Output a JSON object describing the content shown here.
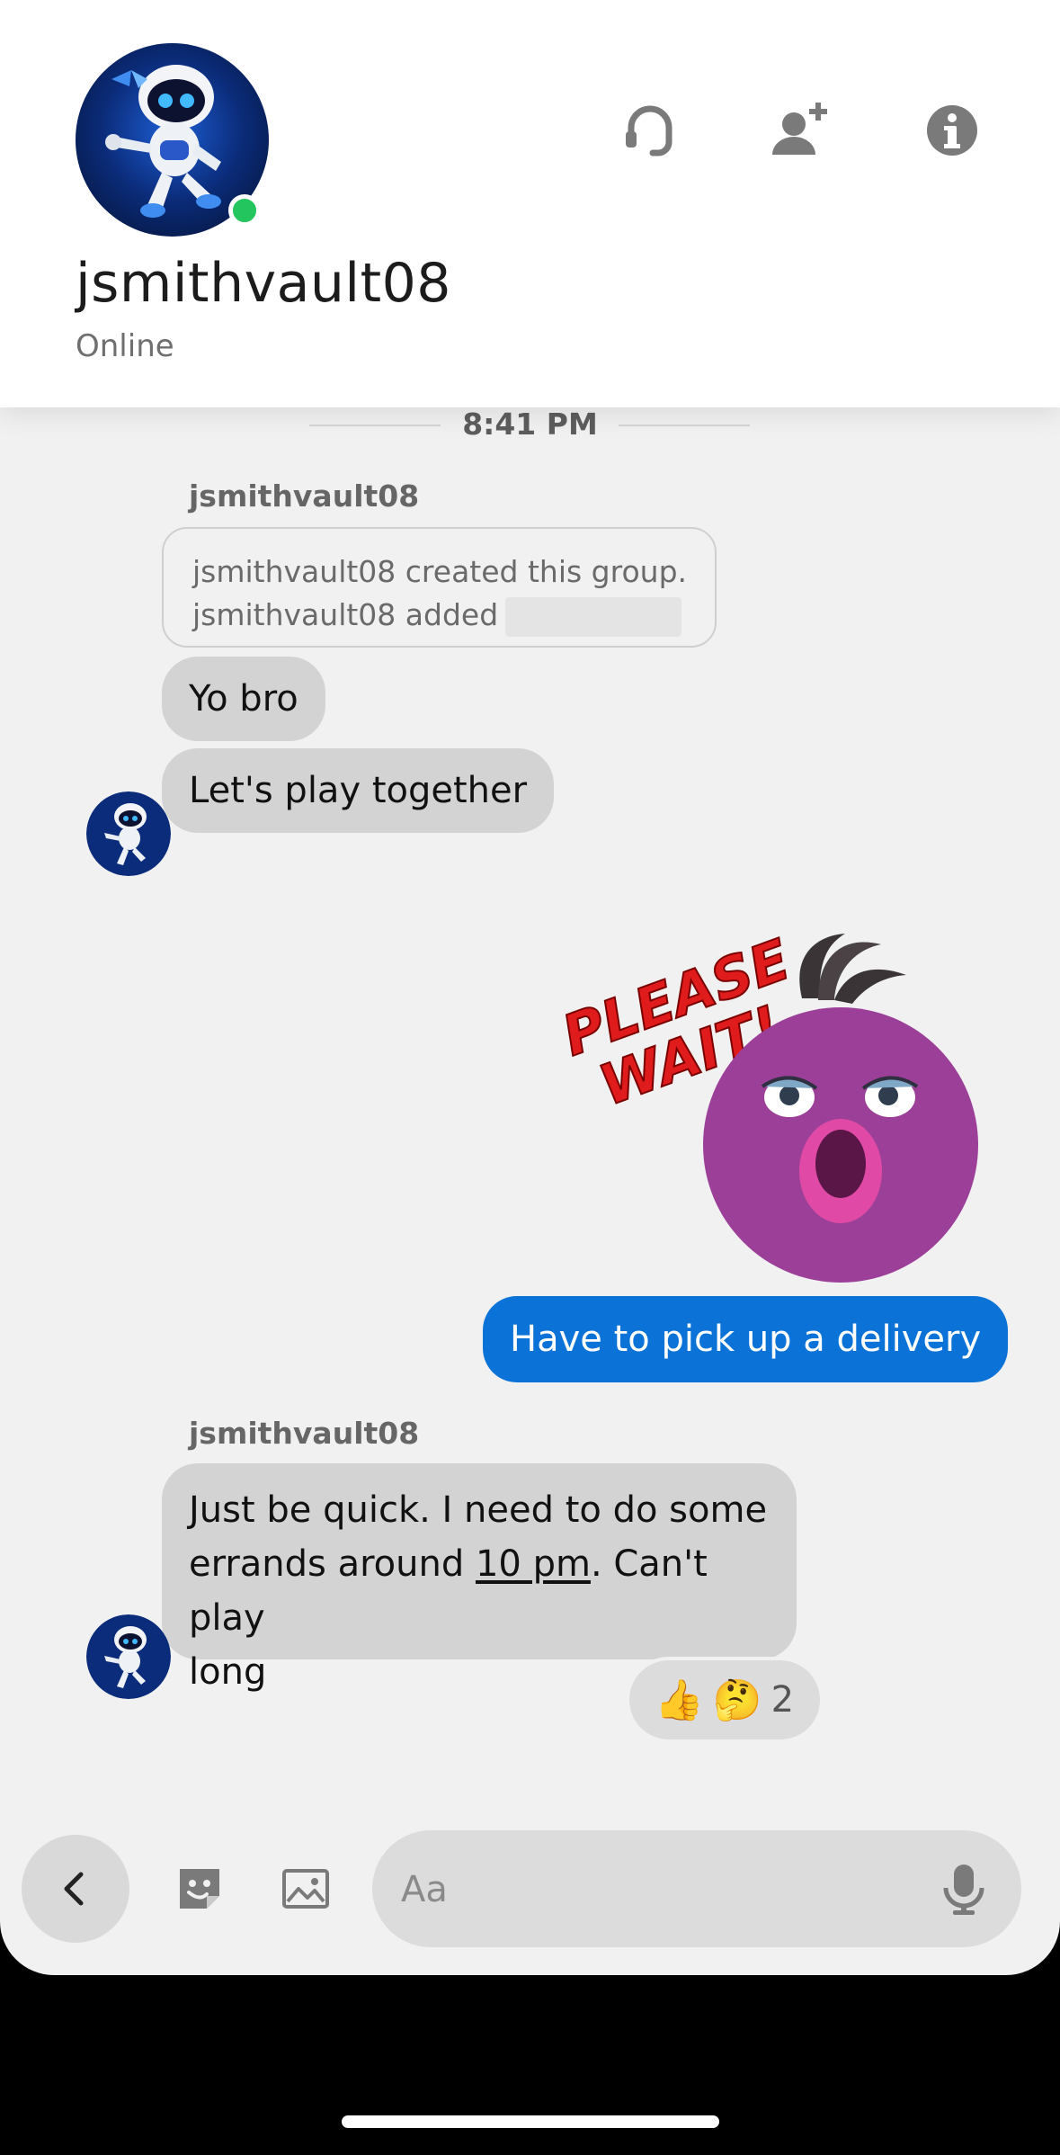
{
  "header": {
    "username": "jsmithvault08",
    "status": "Online",
    "icons": [
      "headset-icon",
      "add-friend-icon",
      "info-icon"
    ]
  },
  "timestamp": "8:41 PM",
  "messages": {
    "sender_1": "jsmithvault08",
    "system_line_1": "jsmithvault08 created this group.",
    "system_line_2_prefix": "jsmithvault08 added",
    "system_line_2_suffix": ".",
    "bubble_1": "Yo bro",
    "bubble_2": "Let's play together",
    "sticker_text_1": "PLEASE",
    "sticker_text_2": "WAIT!",
    "outgoing_1": "Have to pick up a delivery",
    "sender_2": "jsmithvault08",
    "long_line_1": "Just be quick. I need to do some",
    "long_line_2_prefix": "errands around ",
    "long_line_2_link": "10 pm",
    "long_line_2_suffix": ". Can't play",
    "long_line_3": "long",
    "reaction_emoji_1": "👍",
    "reaction_emoji_2": "🤔",
    "reaction_count": "2"
  },
  "composer": {
    "placeholder": "Aa"
  },
  "colors": {
    "outgoing_bubble": "#0b73d8",
    "incoming_bubble": "#d3d3d3",
    "online": "#22c55e",
    "sticker_purple": "#9b3f98",
    "sticker_text": "#e01b1b"
  }
}
